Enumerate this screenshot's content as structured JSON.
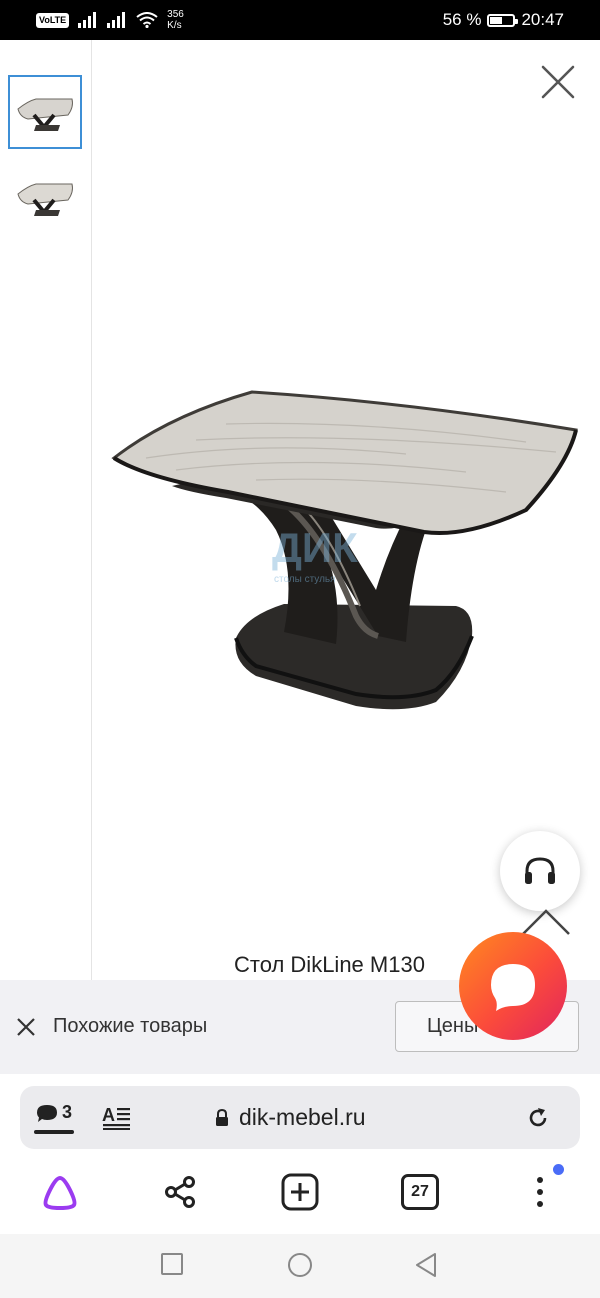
{
  "status_bar": {
    "volte": "VoLTE",
    "net_speed_value": "356",
    "net_speed_unit": "K/s",
    "battery_text": "56 %",
    "battery_level": 0.56,
    "time": "20:47"
  },
  "gallery": {
    "thumbnails": [
      {
        "icon": "table-thumbnail-1",
        "selected": true
      },
      {
        "icon": "table-thumbnail-2",
        "selected": false
      }
    ],
    "watermark": "ДИК",
    "watermark_sub": "столы стулья"
  },
  "product": {
    "title": "Стол DikLine M130"
  },
  "similar": {
    "label": "Похожие товары",
    "price_button": "Цены",
    "price_arrow": "^"
  },
  "browser": {
    "comments_count": "3",
    "url": "dik-mebel.ru",
    "tabs_count": "27"
  },
  "colors": {
    "accent_blue": "#3d8fd6",
    "alice_purple": "#9b3bf0",
    "chat_gradient_start": "#ff8a1f",
    "chat_gradient_end": "#e0245e",
    "menu_dot": "#4a6cf7"
  }
}
